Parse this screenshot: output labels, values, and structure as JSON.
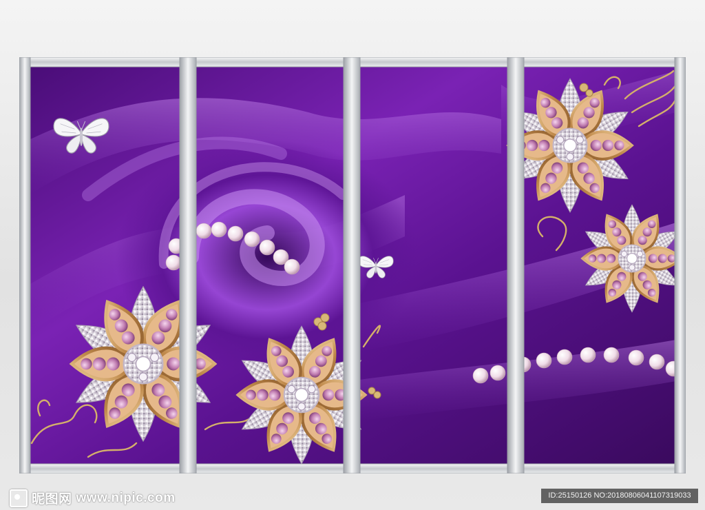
{
  "artwork": {
    "panel_count": 4,
    "colors": {
      "satin_dark": "#3a0a5e",
      "satin_mid": "#6a1aa0",
      "satin_light": "#b06ae0",
      "frame_silver": "#cfd2d6",
      "gold": "#c89a5a",
      "gem_pink": "#c88ab8",
      "pearl": "#f3eaf0"
    },
    "decor": [
      "butterfly-icon",
      "jewel-flower-icon",
      "pearl-strand-icon",
      "gold-vine-icon"
    ]
  },
  "watermark": {
    "site_name": "昵图网",
    "url": "www.nipic.com"
  },
  "image_id": "ID:25150126 NO:20180806041107319033"
}
